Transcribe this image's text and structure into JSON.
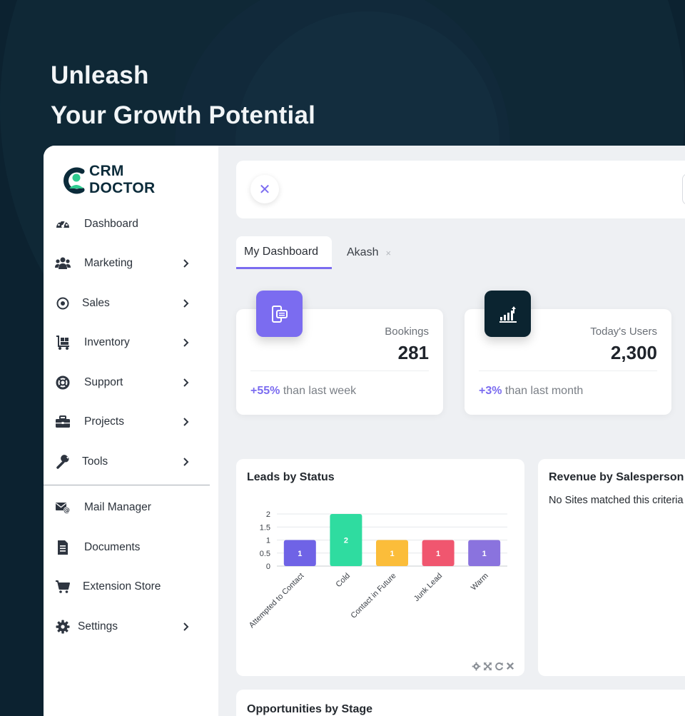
{
  "hero": {
    "line1": "Unleash",
    "line2": "Your Growth Potential"
  },
  "brand": {
    "line1": "CRM",
    "line2": "DOCTOR",
    "accent": "#2ecb8f",
    "dark": "#0b2b3a"
  },
  "sidebar": {
    "items": [
      {
        "label": "Dashboard",
        "icon": "dashboard-gauge-icon",
        "chevron": false
      },
      {
        "label": "Marketing",
        "icon": "users-group-icon",
        "chevron": true
      },
      {
        "label": "Sales",
        "icon": "target-icon",
        "chevron": true
      },
      {
        "label": "Inventory",
        "icon": "dolly-icon",
        "chevron": true
      },
      {
        "label": "Support",
        "icon": "life-ring-icon",
        "chevron": true
      },
      {
        "label": "Projects",
        "icon": "briefcase-icon",
        "chevron": true
      },
      {
        "label": "Tools",
        "icon": "wrench-icon",
        "chevron": true
      },
      {
        "label": "Mail Manager",
        "icon": "mail-at-icon",
        "chevron": false
      },
      {
        "label": "Documents",
        "icon": "document-icon",
        "chevron": false
      },
      {
        "label": "Extension Store",
        "icon": "cart-icon",
        "chevron": false
      },
      {
        "label": "Settings",
        "icon": "gear-icon",
        "chevron": true
      }
    ]
  },
  "topbar": {
    "close_symbol": "✕"
  },
  "tabs": [
    {
      "label": "My Dashboard",
      "active": true
    },
    {
      "label": "Akash",
      "active": false,
      "close_symbol": "×"
    }
  ],
  "stats": [
    {
      "label": "Bookings",
      "value": "281",
      "delta": "+55%",
      "note": " than last week",
      "icon": "booking-icon",
      "icon_bg": "#7b6cf0"
    },
    {
      "label": "Today's Users",
      "value": "2,300",
      "delta": "+3%",
      "note": " than last month",
      "icon": "growth-chart-icon",
      "icon_bg": "#0b2430"
    }
  ],
  "leads_panel": {
    "title": "Leads by Status"
  },
  "revenue_panel": {
    "title": "Revenue by Salesperson",
    "message": "No Sites matched this criteria"
  },
  "opps_panel": {
    "title": "Opportunities by Stage"
  },
  "chart_data": {
    "type": "bar",
    "title": "Leads by Status",
    "categories": [
      "Attempted to Contact",
      "Cold",
      "Contact in Future",
      "Junk Lead",
      "Warm"
    ],
    "values": [
      1,
      2,
      1,
      1,
      1
    ],
    "colors": [
      "#6f63e6",
      "#2fdca0",
      "#fbbd3a",
      "#f0566f",
      "#8a73de"
    ],
    "ylim": [
      0,
      2
    ],
    "yticks": [
      "0",
      "0.5",
      "1",
      "1.5",
      "2"
    ],
    "grid": true,
    "data_labels": true
  }
}
